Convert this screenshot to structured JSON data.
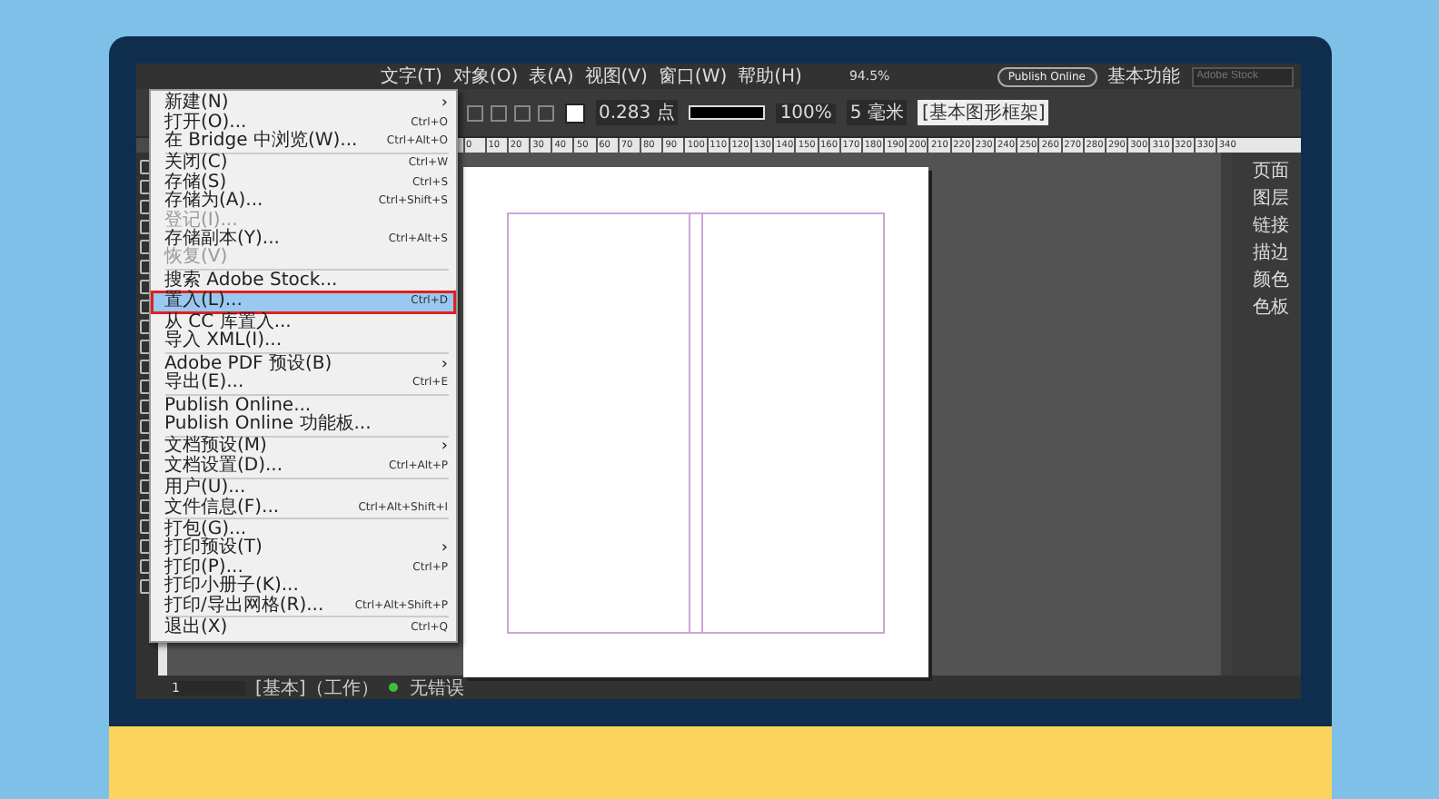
{
  "menu_bar": [
    {
      "label": "文字(T)"
    },
    {
      "label": "对象(O)"
    },
    {
      "label": "表(A)"
    },
    {
      "label": "视图(V)"
    },
    {
      "label": "窗口(W)"
    },
    {
      "label": "帮助(H)"
    }
  ],
  "zoom": "94.5%",
  "publish_button": "Publish Online",
  "workspace": "基本功能",
  "search": {
    "placeholder": "Adobe Stock"
  },
  "control_bar": {
    "stroke_weight": "0.283 点",
    "scale": "100%",
    "gutter": "5 毫米",
    "object_style": "[基本图形框架]"
  },
  "ruler": [
    "0",
    "10",
    "20",
    "30",
    "40",
    "50",
    "60",
    "70",
    "80",
    "90",
    "100",
    "110",
    "120",
    "130",
    "140",
    "150",
    "160",
    "170",
    "180",
    "190",
    "200",
    "210",
    "220",
    "230",
    "240",
    "250",
    "260",
    "270",
    "280",
    "290",
    "300",
    "310",
    "320",
    "330",
    "340"
  ],
  "file_menu": [
    [
      {
        "label": "新建(N)",
        "submenu": true,
        "disabled": false,
        "selected": false,
        "annotated": false
      },
      {
        "label": "打开(O)...",
        "shortcut": "Ctrl+O",
        "submenu": false,
        "disabled": false,
        "selected": false,
        "annotated": false
      },
      {
        "label": "在 Bridge 中浏览(W)...",
        "shortcut": "Ctrl+Alt+O",
        "submenu": false,
        "disabled": false,
        "selected": false,
        "annotated": false
      }
    ],
    [
      {
        "label": "关闭(C)",
        "shortcut": "Ctrl+W",
        "submenu": false,
        "disabled": false,
        "selected": false,
        "annotated": false
      },
      {
        "label": "存储(S)",
        "shortcut": "Ctrl+S",
        "submenu": false,
        "disabled": false,
        "selected": false,
        "annotated": false
      },
      {
        "label": "存储为(A)...",
        "shortcut": "Ctrl+Shift+S",
        "submenu": false,
        "disabled": false,
        "selected": false,
        "annotated": false
      },
      {
        "label": "登记(I)...",
        "submenu": false,
        "disabled": true,
        "selected": false,
        "annotated": false
      },
      {
        "label": "存储副本(Y)...",
        "shortcut": "Ctrl+Alt+S",
        "submenu": false,
        "disabled": false,
        "selected": false,
        "annotated": false
      },
      {
        "label": "恢复(V)",
        "submenu": false,
        "disabled": true,
        "selected": false,
        "annotated": false
      }
    ],
    [
      {
        "label": "搜索 Adobe Stock...",
        "submenu": false,
        "disabled": false,
        "selected": false,
        "annotated": false
      },
      {
        "label": "置入(L)...",
        "shortcut": "Ctrl+D",
        "submenu": false,
        "disabled": false,
        "selected": true,
        "annotated": true
      },
      {
        "label": "从 CC 库置入...",
        "submenu": false,
        "disabled": false,
        "selected": false,
        "annotated": false
      },
      {
        "label": "导入 XML(I)...",
        "submenu": false,
        "disabled": false,
        "selected": false,
        "annotated": false
      }
    ],
    [
      {
        "label": "Adobe PDF 预设(B)",
        "submenu": true,
        "disabled": false,
        "selected": false,
        "annotated": false
      },
      {
        "label": "导出(E)...",
        "shortcut": "Ctrl+E",
        "submenu": false,
        "disabled": false,
        "selected": false,
        "annotated": false
      }
    ],
    [
      {
        "label": "Publish Online...",
        "submenu": false,
        "disabled": false,
        "selected": false,
        "annotated": false
      },
      {
        "label": "Publish Online 功能板...",
        "submenu": false,
        "disabled": false,
        "selected": false,
        "annotated": false
      }
    ],
    [
      {
        "label": "文档预设(M)",
        "submenu": true,
        "disabled": false,
        "selected": false,
        "annotated": false
      },
      {
        "label": "文档设置(D)...",
        "shortcut": "Ctrl+Alt+P",
        "submenu": false,
        "disabled": false,
        "selected": false,
        "annotated": false
      }
    ],
    [
      {
        "label": "用户(U)...",
        "submenu": false,
        "disabled": false,
        "selected": false,
        "annotated": false
      },
      {
        "label": "文件信息(F)...",
        "shortcut": "Ctrl+Alt+Shift+I",
        "submenu": false,
        "disabled": false,
        "selected": false,
        "annotated": false
      }
    ],
    [
      {
        "label": "打包(G)...",
        "submenu": false,
        "disabled": false,
        "selected": false,
        "annotated": false
      },
      {
        "label": "打印预设(T)",
        "submenu": true,
        "disabled": false,
        "selected": false,
        "annotated": false
      },
      {
        "label": "打印(P)...",
        "shortcut": "Ctrl+P",
        "submenu": false,
        "disabled": false,
        "selected": false,
        "annotated": false
      },
      {
        "label": "打印小册子(K)...",
        "submenu": false,
        "disabled": false,
        "selected": false,
        "annotated": false
      },
      {
        "label": "打印/导出网格(R)...",
        "shortcut": "Ctrl+Alt+Shift+P",
        "submenu": false,
        "disabled": false,
        "selected": false,
        "annotated": false
      }
    ],
    [
      {
        "label": "退出(X)",
        "shortcut": "Ctrl+Q",
        "submenu": false,
        "disabled": false,
        "selected": false,
        "annotated": false
      }
    ]
  ],
  "submenu_arrow": "›",
  "panels": [
    {
      "label": "页面"
    },
    {
      "label": "图层"
    },
    {
      "label": "链接"
    },
    {
      "label": "描边"
    },
    {
      "label": "颜色"
    },
    {
      "label": "色板"
    }
  ],
  "status_bar": {
    "page": "1",
    "style": "[基本]（工作）",
    "preflight": "无错误"
  }
}
